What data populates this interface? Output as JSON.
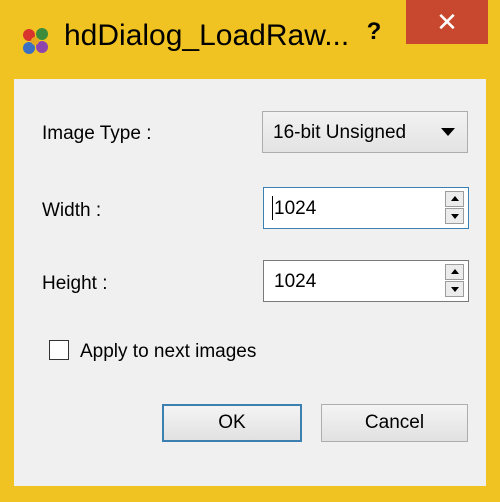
{
  "window": {
    "title": "hdDialog_LoadRaw...",
    "help_label": "?",
    "close_label": "✕",
    "frame_color": "#f0c322",
    "close_color": "#c7482e"
  },
  "form": {
    "image_type_label": "Image Type :",
    "image_type_value": "16-bit Unsigned",
    "width_label": "Width :",
    "width_value": "1024",
    "height_label": "Height :",
    "height_value": "1024",
    "apply_label": "Apply to next images",
    "apply_checked": false
  },
  "buttons": {
    "ok_label": "OK",
    "cancel_label": "Cancel"
  },
  "icons": {
    "app": "app-logo-icon",
    "combo_arrow": "chevron-down-icon",
    "spin_up": "spin-up-icon",
    "spin_down": "spin-down-icon"
  }
}
